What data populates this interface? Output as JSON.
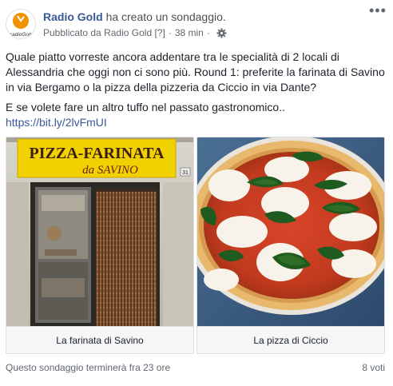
{
  "header": {
    "author": "Radio Gold",
    "action": "ha creato un sondaggio.",
    "published_prefix": "Pubblicato da",
    "published_by": "Radio Gold",
    "help_marker": "[?]",
    "separator": "·",
    "time": "38 min",
    "avatar_text": "radioGold",
    "more_icon": "more-horizontal-icon",
    "privacy_icon": "gear-icon"
  },
  "post": {
    "text": "Quale piatto vorreste ancora addentare tra le specialità di 2 locali di Alessandria che oggi non ci sono più. Round 1: preferite la farinata di Savino in via Bergamo o la pizza della pizzeria da Ciccio in via Dante?",
    "text2": "E se volete fare un altro tuffo nel passato gastronomico..",
    "url": "https://bit.ly/2lvFmUI"
  },
  "poll": {
    "options": [
      {
        "label": "La farinata di Savino",
        "sign_line1": "PIZZA-FARINATA",
        "sign_line2": "da SAVINO",
        "door_number": "31"
      },
      {
        "label": "La pizza di Ciccio"
      }
    ],
    "ends": "Questo sondaggio terminerà fra 23 ore",
    "votes": "8 voti"
  },
  "colors": {
    "link": "#385898",
    "text": "#1d2129",
    "muted": "#616770",
    "border": "#dddfe2",
    "brand_orange": "#f39200"
  }
}
